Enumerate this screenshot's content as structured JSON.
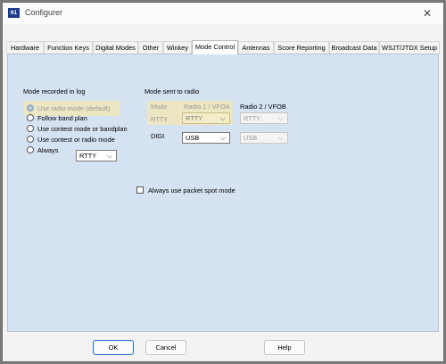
{
  "window": {
    "icon_text": "N1",
    "title": "Configurer",
    "close_symbol": "✕"
  },
  "tabs": [
    {
      "label": "Hardware"
    },
    {
      "label": "Function Keys"
    },
    {
      "label": "Digital Modes"
    },
    {
      "label": "Other"
    },
    {
      "label": "Winkey"
    },
    {
      "label": "Mode Control",
      "active": true
    },
    {
      "label": "Antennas"
    },
    {
      "label": "Score Reporting"
    },
    {
      "label": "Broadcast Data"
    },
    {
      "label": "WSJT/JTDX Setup"
    }
  ],
  "mode_log": {
    "heading": "Mode recorded in log",
    "options": [
      {
        "label": "Use radio mode (default)",
        "checked": true,
        "disabled": true
      },
      {
        "label": "Follow band plan"
      },
      {
        "label": "Use contest mode or bandplan"
      },
      {
        "label": "Use contest or radio mode"
      },
      {
        "label": "Always"
      }
    ],
    "always_value": "RTTY"
  },
  "mode_radio": {
    "heading": "Mode sent to radio",
    "col_mode": "Mode",
    "col_radio1": "Radio 1 / VFOA",
    "col_radio2": "Radio 2 / VFOB",
    "rows": [
      {
        "mode": "RTTY",
        "radio1": "RTTY",
        "radio2": "RTTY"
      },
      {
        "mode": "DIGI",
        "radio1": "USB",
        "radio2": "USB"
      }
    ]
  },
  "packet_spot": {
    "label": "Always use packet spot mode",
    "checked": false
  },
  "buttons": {
    "ok": "OK",
    "cancel": "Cancel",
    "help": "Help"
  },
  "icons": {
    "chevron": "⌵"
  }
}
